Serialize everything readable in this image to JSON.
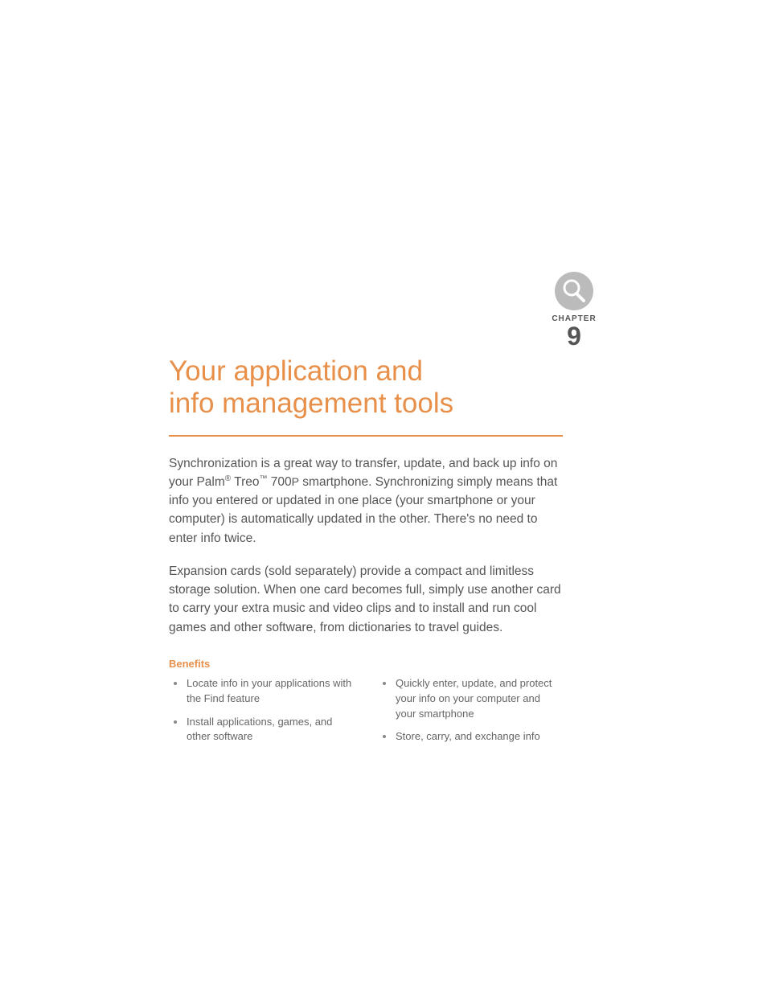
{
  "chapter": {
    "label": "CHAPTER",
    "number": "9"
  },
  "title_line1": "Your application and",
  "title_line2": "info management tools",
  "paragraph1_pre": "Synchronization is a great way to transfer, update, and back up info on your Palm",
  "paragraph1_mid": " Treo",
  "paragraph1_product": " 700",
  "paragraph1_p": "P",
  "paragraph1_post": " smartphone. Synchronizing simply means that info you entered or updated in one place (your smartphone or your computer) is automatically updated in the other. There's no need to enter info twice.",
  "paragraph2": "Expansion cards (sold separately) provide a compact and limitless storage solution. When one card becomes full, simply use another card to carry your extra music and video clips and to install and run cool games and other software, from dictionaries to travel guides.",
  "benefits": {
    "heading": "Benefits",
    "left": [
      "Locate info in your applications with the Find feature",
      "Install applications, games, and other software"
    ],
    "right": [
      "Quickly enter, update, and protect your info on your computer and your smartphone",
      "Store, carry, and exchange info"
    ]
  }
}
